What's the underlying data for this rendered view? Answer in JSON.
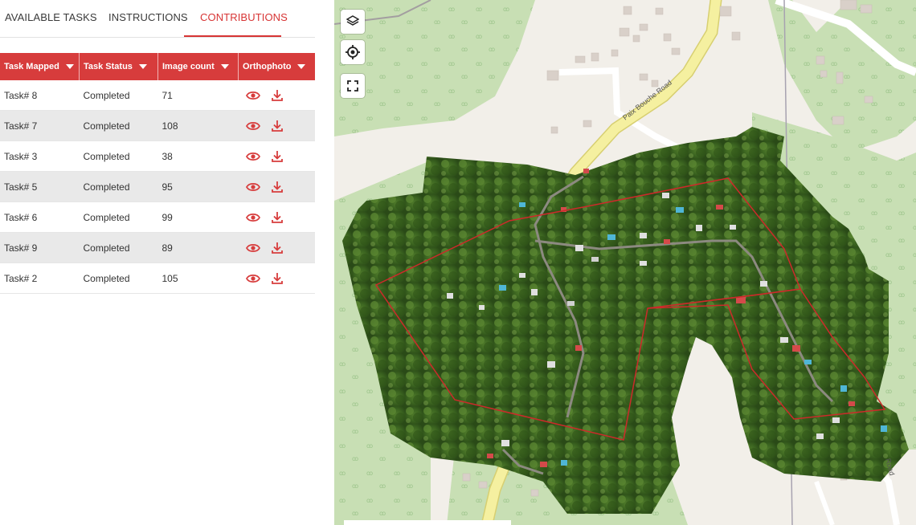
{
  "tabs": [
    {
      "label": "AVAILABLE TASKS"
    },
    {
      "label": "INSTRUCTIONS"
    },
    {
      "label": "CONTRIBUTIONS",
      "active": true
    }
  ],
  "table": {
    "columns": [
      "Task Mapped",
      "Task Status",
      "Image count",
      "Orthophoto"
    ],
    "rows": [
      {
        "task": "Task# 8",
        "status": "Completed",
        "images": "71"
      },
      {
        "task": "Task# 7",
        "status": "Completed",
        "images": "108"
      },
      {
        "task": "Task# 3",
        "status": "Completed",
        "images": "38"
      },
      {
        "task": "Task# 5",
        "status": "Completed",
        "images": "95"
      },
      {
        "task": "Task# 6",
        "status": "Completed",
        "images": "99"
      },
      {
        "task": "Task# 9",
        "status": "Completed",
        "images": "89"
      },
      {
        "task": "Task# 2",
        "status": "Completed",
        "images": "105"
      }
    ]
  },
  "map": {
    "road_labels": [
      "Paix Bouche Road",
      "Road"
    ],
    "controls": [
      "layers-icon",
      "locate-icon",
      "fullscreen-icon"
    ]
  },
  "colors": {
    "accent": "#d73c3c",
    "alt_row": "#e9e9e9",
    "map_bg": "#f2efe9",
    "park_green": "#c8dfb4",
    "road_yellow": "#f5f0a0"
  }
}
